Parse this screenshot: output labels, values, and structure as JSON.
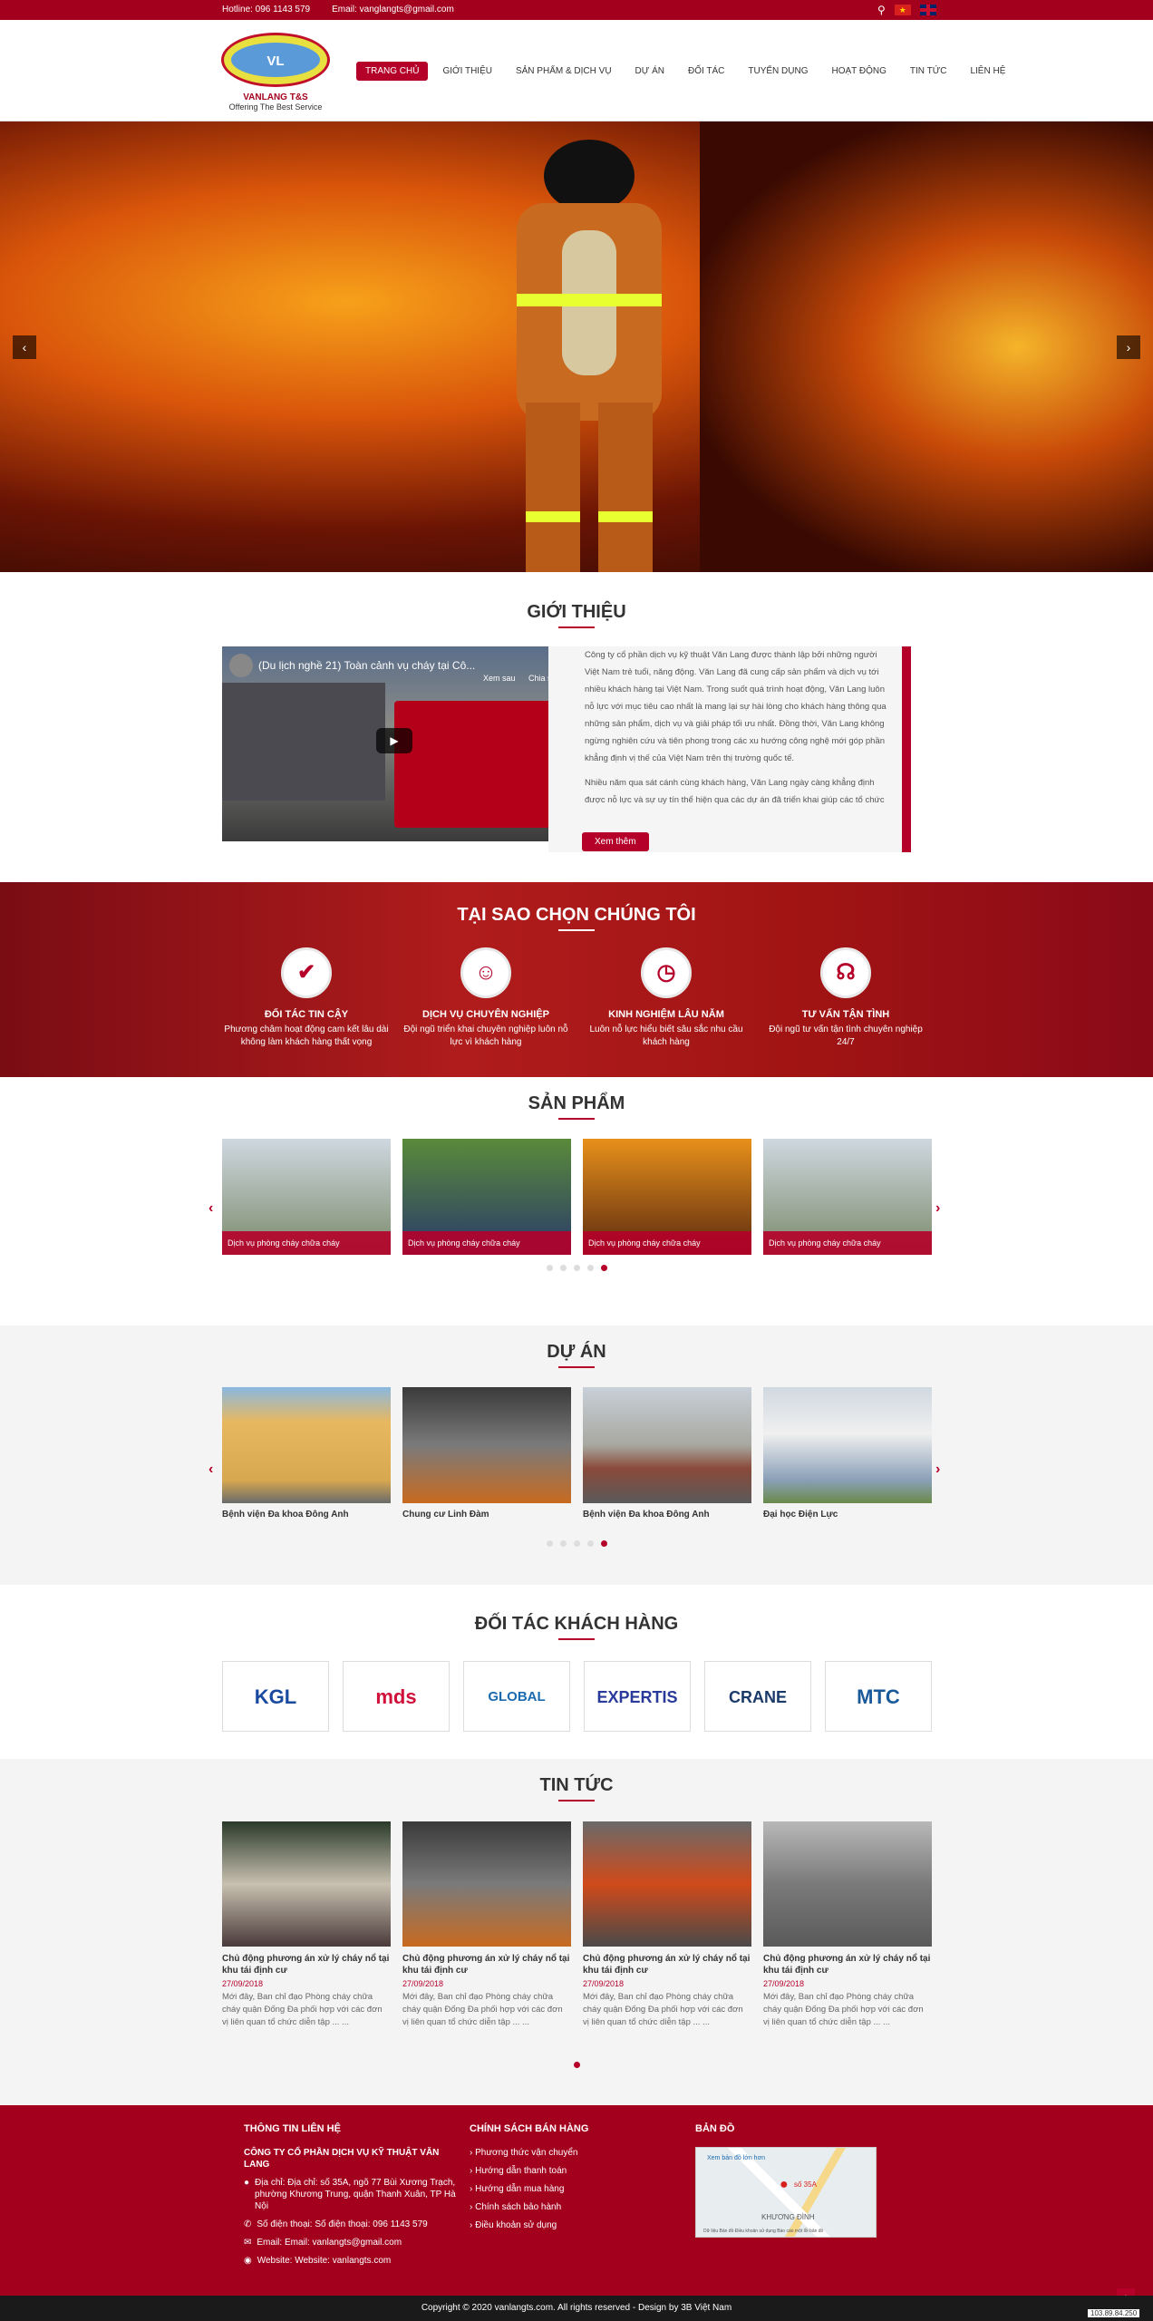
{
  "topbar": {
    "hotline": "Hotline: 096 1143 579",
    "email": "Email: vanglangts@gmail.com"
  },
  "logo": {
    "emblem": "VL",
    "name": "VANLANG T&S",
    "tagline": "Offering The Best Service"
  },
  "nav": [
    "TRANG CHỦ",
    "GIỚI THIỆU",
    "SẢN PHẨM & DỊCH VỤ",
    "DỰ ÁN",
    "ĐỐI TÁC",
    "TUYỂN DỤNG",
    "HOẠT ĐỘNG",
    "TIN TỨC",
    "LIÊN HỆ"
  ],
  "intro": {
    "title": "GIỚI THIỆU",
    "video_title": "(Du lịch nghề 21) Toàn cảnh vụ cháy tại Cô...",
    "watch_later": "Xem sau",
    "share": "Chia sẻ",
    "p1": "Công ty cổ phần dịch vụ kỹ thuật Văn Lang được thành lập bởi những người Việt Nam trẻ tuổi, năng động. Văn Lang đã cung cấp sản phẩm và dịch vụ tới nhiều khách hàng tại Việt Nam. Trong suốt quá trình hoạt động, Văn Lang luôn nỗ lực với mục tiêu cao nhất là mang lại sự hài lòng cho khách hàng thông qua những sản phẩm, dịch vụ và giải pháp tối ưu nhất. Đồng thời, Văn Lang không ngừng nghiên cứu và tiên phong trong các xu hướng công nghệ mới góp phần khẳng định vị thế của Việt Nam trên thị trường quốc tế.",
    "p2": "Nhiều năm qua sát cánh cùng khách hàng, Văn Lang ngày càng khẳng định được nỗ lực và sự uy tín thể hiện qua các dự án đã triển khai giúp các tổ chức",
    "more": "Xem thêm"
  },
  "why": {
    "title": "TẠI SAO CHỌN CHÚNG TÔI",
    "items": [
      {
        "icon": "✔",
        "h": "ĐỐI TÁC TIN CẬY",
        "d": "Phương châm hoạt động cam kết lâu dài không làm khách hàng thất vọng"
      },
      {
        "icon": "☺",
        "h": "DỊCH VỤ CHUYÊN NGHIỆP",
        "d": "Đội ngũ triển khai chuyên nghiệp luôn nỗ lực vì khách hàng"
      },
      {
        "icon": "◷",
        "h": "KINH NGHIỆM LÂU NĂM",
        "d": "Luôn nỗ lực hiểu biết sâu sắc nhu cầu khách hàng"
      },
      {
        "icon": "☊",
        "h": "TƯ VẤN TẬN TÌNH",
        "d": "Đội ngũ tư vấn tận tình chuyên nghiệp 24/7"
      }
    ]
  },
  "products": {
    "title": "SẢN PHẨM",
    "items": [
      "Dịch vụ phòng cháy chữa cháy",
      "Dịch vụ phòng cháy chữa cháy",
      "Dịch vụ phòng cháy chữa cháy",
      "Dịch vụ phòng cháy chữa cháy"
    ]
  },
  "projects": {
    "title": "DỰ ÁN",
    "items": [
      "Bệnh viện Đa khoa Đông Anh",
      "Chung cư Linh Đàm",
      "Bệnh viện Đa khoa Đông Anh",
      "Đại học Điện Lực"
    ]
  },
  "partners": {
    "title": "ĐỐI TÁC KHÁCH HÀNG",
    "items": [
      "KGL",
      "mds",
      "GLOBAL",
      "EXPERTIS",
      "CRANE",
      "MTC"
    ]
  },
  "news": {
    "title": "TIN TỨC",
    "items": [
      {
        "h": "Chủ động phương án xử lý cháy nổ tại khu tái định cư",
        "dt": "27/09/2018",
        "d": "Mới đây, Ban chỉ đạo Phòng cháy chữa cháy quận Đống Đa phối hợp với các đơn vị liên quan tổ chức diễn tập ... ..."
      },
      {
        "h": "Chủ động phương án xử lý cháy nổ tại khu tái định cư",
        "dt": "27/09/2018",
        "d": "Mới đây, Ban chỉ đạo Phòng cháy chữa cháy quận Đống Đa phối hợp với các đơn vị liên quan tổ chức diễn tập ... ..."
      },
      {
        "h": "Chủ động phương án xử lý cháy nổ tại khu tái định cư",
        "dt": "27/09/2018",
        "d": "Mới đây, Ban chỉ đạo Phòng cháy chữa cháy quận Đống Đa phối hợp với các đơn vị liên quan tổ chức diễn tập ... ..."
      },
      {
        "h": "Chủ động phương án xử lý cháy nổ tại khu tái định cư",
        "dt": "27/09/2018",
        "d": "Mới đây, Ban chỉ đạo Phòng cháy chữa cháy quận Đống Đa phối hợp với các đơn vị liên quan tổ chức diễn tập ... ..."
      }
    ]
  },
  "footer": {
    "contact_title": "THÔNG TIN LIÊN HỆ",
    "company": "CÔNG TY CỔ PHẦN DỊCH VỤ KỸ THUẬT VĂN LANG",
    "address": "Địa chỉ: Địa chỉ: số 35A, ngõ 77 Bùi Xương Trạch, phường Khương Trung, quận Thanh Xuân, TP Hà Nội",
    "phone": "Số điện thoại: Số điện thoại: 096 1143 579",
    "email": "Email: Email: vanlangts@gmail.com",
    "website": "Website: Website: vanlangts.com",
    "policy_title": "CHÍNH SÁCH BÁN HÀNG",
    "policies": [
      "Phương thức vận chuyển",
      "Hướng dẫn thanh toán",
      "Hướng dẫn mua hàng",
      "Chính sách bảo hành",
      "Điều khoản sử dụng"
    ],
    "map_title": "BẢN ĐỒ",
    "map_link": "Xem bản đồ lớn hơn",
    "map_pin": "số 35A",
    "map_area": "KHƯƠNG ĐÌNH",
    "map_credit": "Dữ liệu Bản đồ    Điều khoản sử dụng    Báo cáo một lỗi bản đồ",
    "copyright": "Copyright © 2020 vanlangts.com. All rights reserved - Design by 3B Việt Nam",
    "ip": "103.89.84.250"
  }
}
